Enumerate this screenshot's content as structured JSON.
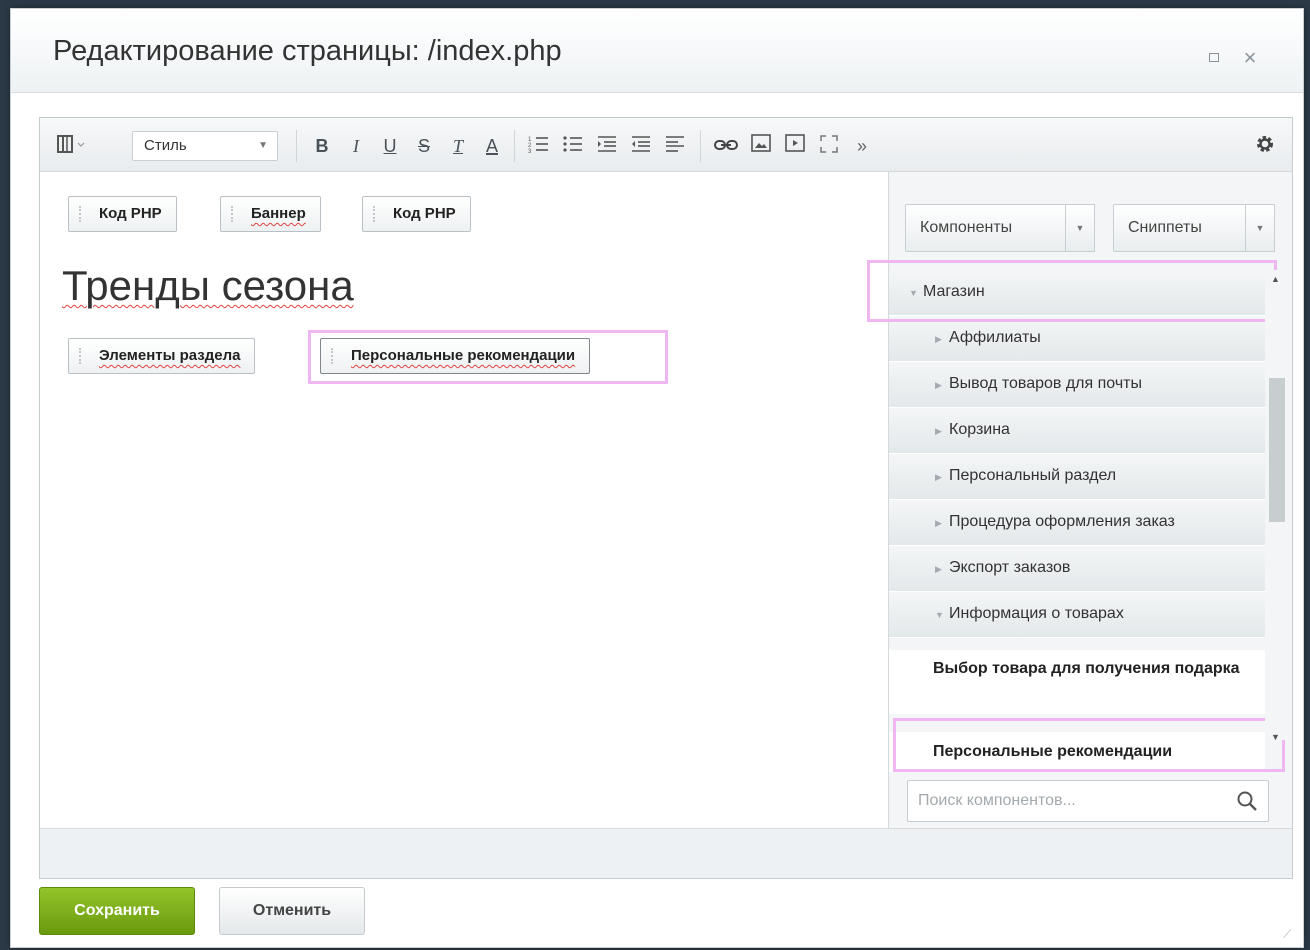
{
  "dialog": {
    "title": "Редактирование страницы: /index.php"
  },
  "toolbar": {
    "style_select": "Стиль",
    "buttons": [
      "B",
      "I",
      "U",
      "S",
      "T",
      "A"
    ]
  },
  "content": {
    "top_chips": [
      "Код PHP",
      "Баннер",
      "Код PHP"
    ],
    "heading": "Тренды сезона",
    "chips_row2": [
      "Элементы раздела",
      "Персональные рекомендации"
    ]
  },
  "sidebar": {
    "components_button": "Компоненты",
    "snippets_button": "Сниппеты",
    "tree": [
      {
        "label": "Магазин",
        "expanded": true,
        "level": 0
      },
      {
        "label": "Аффилиаты",
        "expanded": false,
        "level": 1
      },
      {
        "label": "Вывод товаров для почты",
        "expanded": false,
        "level": 1
      },
      {
        "label": "Корзина",
        "expanded": false,
        "level": 1
      },
      {
        "label": "Персональный раздел",
        "expanded": false,
        "level": 1
      },
      {
        "label": "Процедура оформления заказ",
        "expanded": false,
        "level": 1
      },
      {
        "label": "Экспорт заказов",
        "expanded": false,
        "level": 1
      },
      {
        "label": "Информация о товарах",
        "expanded": true,
        "level": 1
      }
    ],
    "leaves": [
      "Выбор товара для получения подарка",
      "Персональные рекомендации"
    ],
    "search_placeholder": "Поиск компонентов..."
  },
  "footer": {
    "save": "Сохранить",
    "cancel": "Отменить"
  },
  "colors": {
    "save_green": "#7fb21e",
    "highlight_pink": "#f0b6f2"
  }
}
